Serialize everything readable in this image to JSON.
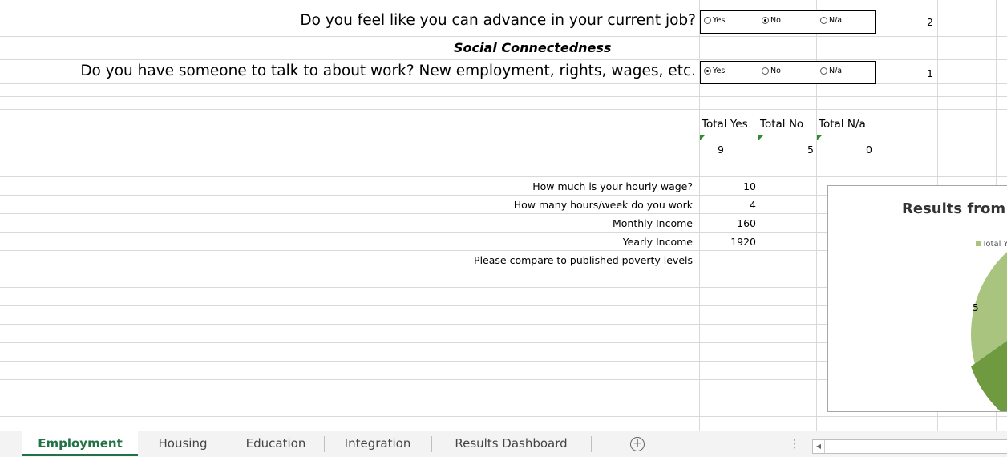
{
  "questions": {
    "advance": "Do you feel like you can advance in your current job?",
    "section": "Social Connectedness",
    "talk": "Do you have someone to talk to about work? New employment, rights, wages, etc."
  },
  "radio": {
    "yes": "Yes",
    "no": "No",
    "na": "N/a",
    "advance_selected": "No",
    "talk_selected": "Yes"
  },
  "values": {
    "advance": "2",
    "talk": "1"
  },
  "totals": {
    "headers": [
      "Total Yes",
      "Total No",
      "Total N/a"
    ],
    "values": [
      "9",
      "5",
      "0"
    ]
  },
  "wage": {
    "labels": [
      "How much is your hourly wage?",
      "How many hours/week do you work",
      "Monthly Income",
      "Yearly Income",
      "Please compare to published poverty levels"
    ],
    "values": [
      "10",
      "4",
      "160",
      "1920"
    ]
  },
  "chart_data": {
    "type": "pie",
    "title": "Results from",
    "legend": [
      "Total Y"
    ],
    "labels": [
      "5"
    ],
    "colors": [
      "#a9c47f",
      "#6f9a3f"
    ]
  },
  "tabs": {
    "items": [
      "Employment",
      "Housing",
      "Education",
      "Integration",
      "Results Dashboard"
    ],
    "active": "Employment",
    "add_icon": "plus-circle-icon"
  }
}
